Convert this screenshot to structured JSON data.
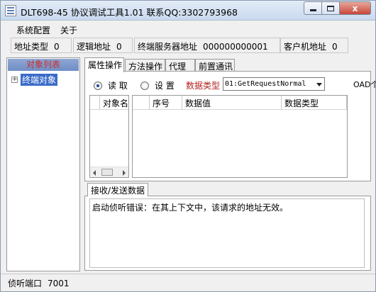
{
  "window": {
    "title": "DLT698-45 协议调试工具1.01  联系QQ:3302793968",
    "close_glyph": "x"
  },
  "menu": {
    "items": [
      "系统配置",
      "关于"
    ]
  },
  "info": {
    "addr_type_label": "地址类型",
    "addr_type_value": "0",
    "logic_addr_label": "逻辑地址",
    "logic_addr_value": "0",
    "server_addr_label": "终端服务器地址",
    "server_addr_value": "000000000001",
    "client_addr_label": "客户机地址",
    "client_addr_value": "0"
  },
  "tree": {
    "header": "对象列表",
    "expander": "+",
    "items": [
      "终端对象"
    ]
  },
  "tabs": [
    "属性操作",
    "方法操作",
    "代理",
    "前置通讯"
  ],
  "attr_panel": {
    "radio_read": "读 取",
    "radio_set": "设 置",
    "data_type_label": "数据类型",
    "data_type_selected": "01:GetRequestNormal",
    "oad_label": "OAD个",
    "object_list_header": "对象名",
    "grid_headers": [
      "序号",
      "数据值",
      "数据类型"
    ]
  },
  "receive": {
    "tab_label": "接收/发送数据",
    "text": "启动侦听错误：在其上下文中，该请求的地址无效。"
  },
  "status": {
    "port_label": "侦听端口",
    "port_value": "7001"
  }
}
